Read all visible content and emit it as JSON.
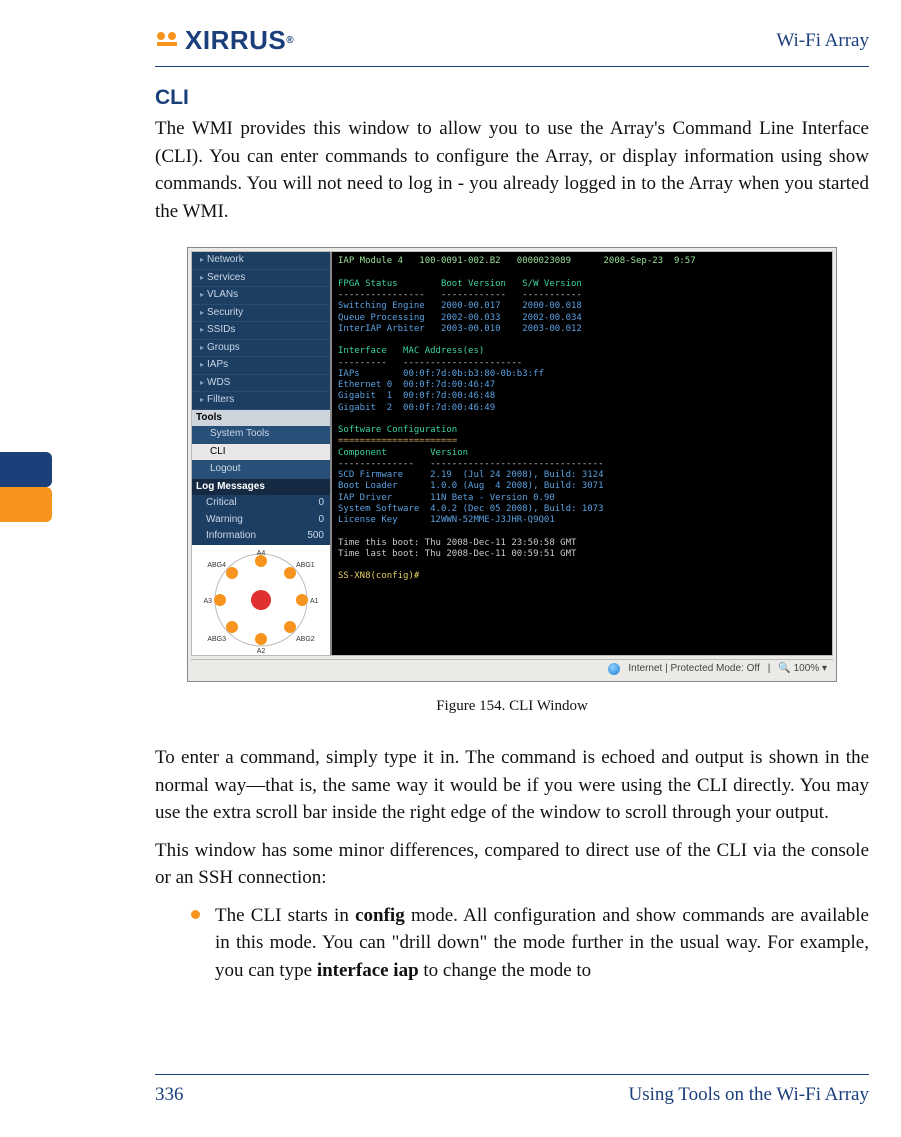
{
  "header": {
    "brand": "XIRRUS",
    "right": "Wi-Fi Array"
  },
  "section_title": "CLI",
  "para1": "The WMI provides this window to allow you to use the Array's Command Line Interface (CLI). You can enter commands to configure the Array, or display information using show commands. You will not need to log in - you already logged in to the Array when you started the WMI.",
  "figure": {
    "caption": "Figure 154. CLI Window",
    "sidebar": {
      "items": [
        "Network",
        "Services",
        "VLANs",
        "Security",
        "SSIDs",
        "Groups",
        "IAPs",
        "WDS",
        "Filters"
      ],
      "tools_header": "Tools",
      "tools": [
        "System Tools",
        "CLI",
        "Logout"
      ],
      "log_header": "Log Messages",
      "logs": [
        {
          "label": "Critical",
          "count": "0"
        },
        {
          "label": "Warning",
          "count": "0"
        },
        {
          "label": "Information",
          "count": "500"
        }
      ],
      "radar_labels": [
        "A4",
        "ABG4",
        "ABG1",
        "A3",
        "A1",
        "ABG3",
        "ABG2",
        "A2"
      ]
    },
    "terminal": {
      "line_top": "IAP Module 4   100-0091-002.B2   0000023089      2008-Sep-23  9:57",
      "fpga_hdr": "FPGA Status        Boot Version   S/W Version",
      "dash1": "----------------   ------------   -----------",
      "rows1": [
        "Switching Engine   2000-00.017    2000-00.018",
        "Queue Processing   2002-00.033    2002-00.034",
        "InterIAP Arbiter   2003-00.010    2003-00.012"
      ],
      "if_hdr": "Interface   MAC Address(es)",
      "dash2": "---------   ----------------------",
      "rows2": [
        "IAPs        00:0f:7d:0b:b3:80-0b:b3:ff",
        "Ethernet 0  00:0f:7d:00:46:47",
        "Gigabit  1  00:0f:7d:00:46:48",
        "Gigabit  2  00:0f:7d:00:46:49"
      ],
      "soft_hdr": "Software Configuration",
      "eq": "======================",
      "comp_hdr": "Component        Version",
      "dash3": "--------------   --------------------------------",
      "rows3": [
        "SCD Firmware     2.19  (Jul 24 2008), Build: 3124",
        "Boot Loader      1.0.0 (Aug  4 2008), Build: 3071",
        "IAP Driver       11N Beta - Version 0.90",
        "System Software  4.0.2 (Dec 05 2008), Build: 1073",
        "License Key      12WWN-52MME-J3JHR-Q9Q01"
      ],
      "time1": "Time this boot: Thu 2008-Dec-11 23:50:58 GMT",
      "time2": "Time last boot: Thu 2008-Dec-11 00:59:51 GMT",
      "prompt": "SS-XN8(config)#"
    },
    "statusbar": {
      "text": "Internet | Protected Mode: Off",
      "zoom": "100%"
    }
  },
  "para2": "To enter a command, simply type it in. The command is echoed and output is shown in the normal way—that is, the same way it would be if you were using the CLI directly. You may use the extra scroll bar inside the right edge of the window to scroll through your output.",
  "para3": "This window has some minor differences, compared to direct use of the CLI via the console or an SSH connection:",
  "bullet1_a": "The CLI starts in ",
  "bullet1_b": "config",
  "bullet1_c": " mode. All configuration and show commands are available in this mode. You can \"drill down\" the mode further in the usual way. For example, you can type ",
  "bullet1_d": "interface iap",
  "bullet1_e": " to change the mode to",
  "footer": {
    "page": "336",
    "title": "Using Tools on the Wi-Fi Array"
  }
}
